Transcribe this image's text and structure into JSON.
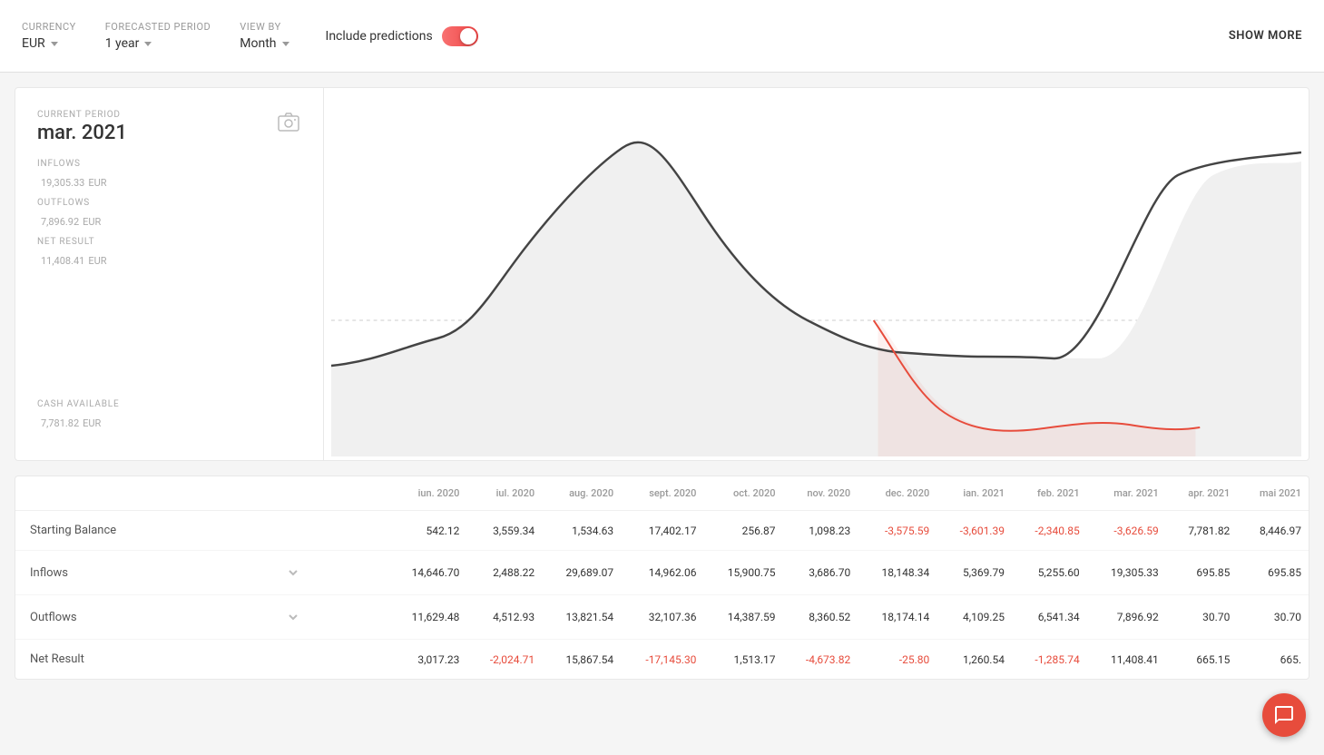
{
  "topbar": {
    "currency_label": "Currency",
    "currency_value": "EUR",
    "forecasted_label": "Forecasted period",
    "forecasted_value": "1 year",
    "viewby_label": "View by",
    "viewby_value": "Month",
    "include_predictions_label": "Include predictions",
    "show_more_label": "SHOW MORE"
  },
  "side_panel": {
    "current_period_label": "CURRENT PERIOD",
    "current_period_value": "mar. 2021",
    "inflows_label": "INFLOWS",
    "inflows_value": "19,305.33",
    "inflows_currency": "EUR",
    "outflows_label": "OUTFLOWS",
    "outflows_value": "7,896.92",
    "outflows_currency": "EUR",
    "net_result_label": "NET RESULT",
    "net_result_value": "11,408.41",
    "net_result_currency": "EUR",
    "cash_available_label": "CASH AVAILABLE",
    "cash_available_value": "7,781.82",
    "cash_available_currency": "EUR"
  },
  "table": {
    "columns": [
      "",
      "iun. 2020",
      "iul. 2020",
      "aug. 2020",
      "sept. 2020",
      "oct. 2020",
      "nov. 2020",
      "dec. 2020",
      "ian. 2021",
      "feb. 2021",
      "mar. 2021",
      "apr. 2021",
      "mai 2021"
    ],
    "rows": [
      {
        "label": "Starting Balance",
        "expandable": false,
        "values": [
          "542.12",
          "3,559.34",
          "1,534.63",
          "17,402.17",
          "256.87",
          "1,098.23",
          "-3,575.59",
          "-3,601.39",
          "-2,340.85",
          "-3,626.59",
          "7,781.82",
          "8,446.97"
        ]
      },
      {
        "label": "Inflows",
        "expandable": true,
        "values": [
          "14,646.70",
          "2,488.22",
          "29,689.07",
          "14,962.06",
          "15,900.75",
          "3,686.70",
          "18,148.34",
          "5,369.79",
          "5,255.60",
          "19,305.33",
          "695.85",
          "695.85"
        ]
      },
      {
        "label": "Outflows",
        "expandable": true,
        "values": [
          "11,629.48",
          "4,512.93",
          "13,821.54",
          "32,107.36",
          "14,387.59",
          "8,360.52",
          "18,174.14",
          "4,109.25",
          "6,541.34",
          "7,896.92",
          "30.70",
          "30.70"
        ]
      },
      {
        "label": "Net Result",
        "expandable": false,
        "values": [
          "3,017.23",
          "-2,024.71",
          "15,867.54",
          "-17,145.30",
          "1,513.17",
          "-4,673.82",
          "-25.80",
          "1,260.54",
          "-1,285.74",
          "11,408.41",
          "665.15",
          "665."
        ]
      }
    ]
  },
  "icons": {
    "camera": "⊙",
    "chevron": "❯",
    "chat": "💬"
  },
  "colors": {
    "accent_red": "#e74c3c",
    "chart_line": "#333",
    "chart_prediction": "#e74c3c",
    "chart_fill": "#f0f0f0"
  }
}
